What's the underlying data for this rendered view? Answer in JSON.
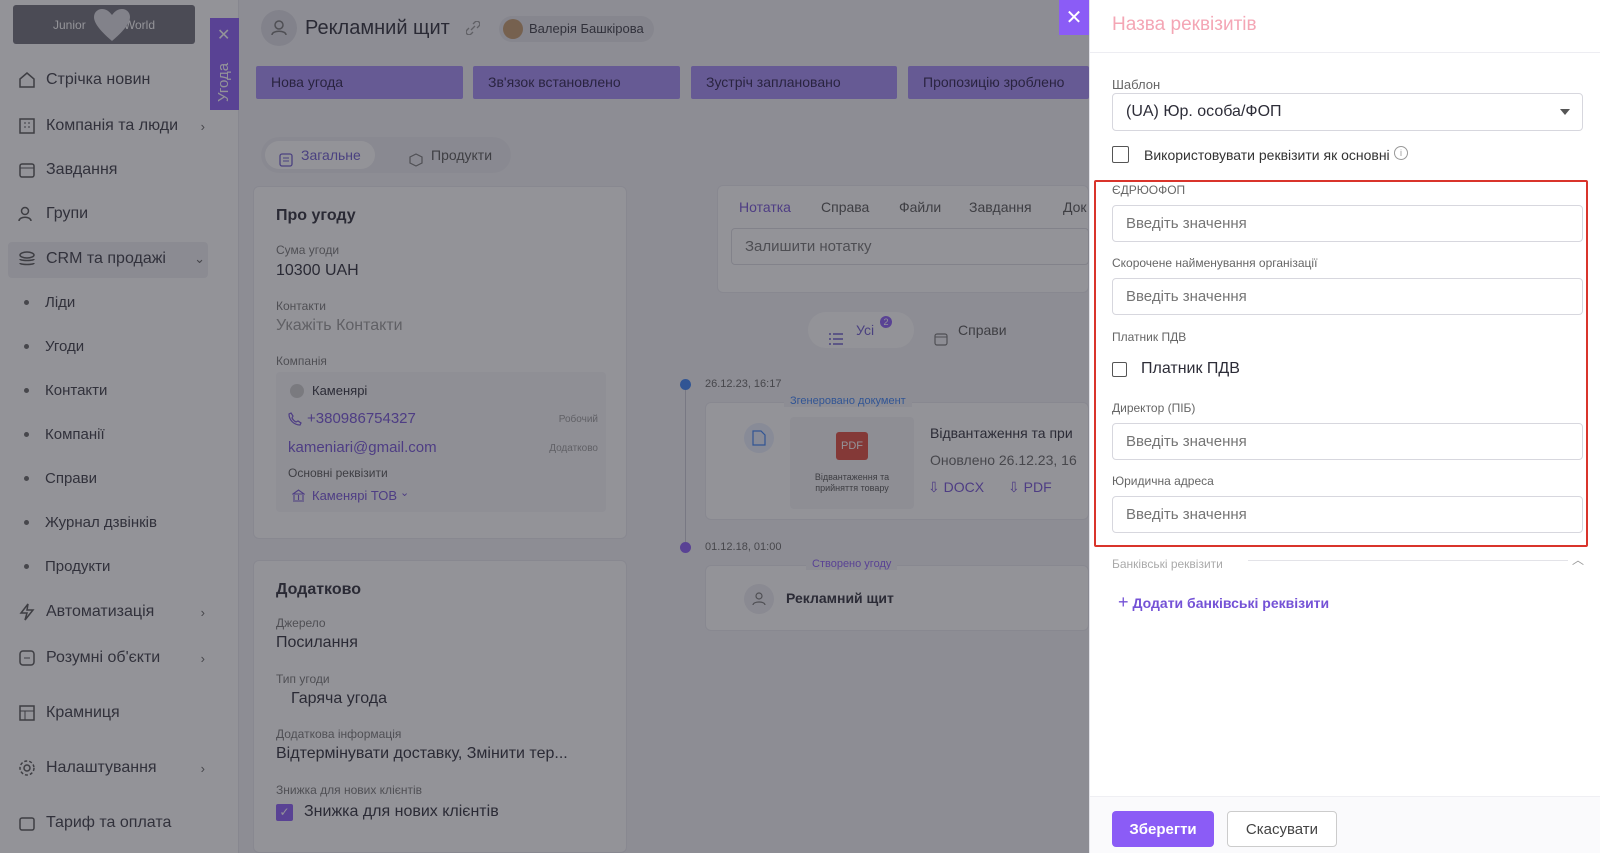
{
  "app": {
    "logo_left": "Junior",
    "logo_right": "World"
  },
  "sidebar": {
    "items": [
      {
        "label": "Стрічка новин",
        "icon": "home-icon"
      },
      {
        "label": "Компанія та люди",
        "icon": "building-icon"
      },
      {
        "label": "Завдання",
        "icon": "calendar-icon"
      },
      {
        "label": "Групи",
        "icon": "users-icon"
      },
      {
        "label": "CRM та продажі",
        "icon": "stack-icon"
      },
      {
        "label": "Автоматизація",
        "icon": "lightning-icon"
      },
      {
        "label": "Розумні об'єкти",
        "icon": "smart-object-icon"
      },
      {
        "label": "Крамниця",
        "icon": "shop-icon"
      },
      {
        "label": "Налаштування",
        "icon": "gear-icon"
      },
      {
        "label": "Тариф та оплата",
        "icon": "wallet-icon"
      }
    ],
    "subitems": [
      "Ліди",
      "Угоди",
      "Контакти",
      "Компанії",
      "Справи",
      "Журнал дзвінків",
      "Продукти"
    ]
  },
  "vertical_tab": {
    "label": "Угода"
  },
  "deal": {
    "title": "Рекламний щит",
    "owner": "Валерія Башкірова",
    "stages": [
      "Нова угода",
      "Зв'язок встановлено",
      "Зустріч заплановано",
      "Пропозицію зроблено"
    ],
    "tabs": [
      "Загальне",
      "Продукти"
    ]
  },
  "about": {
    "title": "Про угоду",
    "sum_label": "Сума угоди",
    "sum_value": "10300 UAH",
    "contacts_label": "Контакти",
    "contacts_placeholder": "Укажіть Контакти",
    "company_label": "Компанія",
    "company_name": "Каменярі",
    "phone": "+380986754327",
    "phone_type": "Робочий",
    "email": "kameniari@gmail.com",
    "email_type": "Додатково",
    "req_label": "Основні реквізити",
    "req_value": "Каменярі ТОВ"
  },
  "extra": {
    "title": "Додатково",
    "source_label": "Джерело",
    "source_value": "Посилання",
    "type_label": "Тип угоди",
    "type_value": "Гаряча угода",
    "info_label": "Додаткова інформація",
    "info_value": "Відтермінувати доставку, Змінити тер...",
    "discount_label": "Знижка для нових клієнтів",
    "discount_value": "Знижка для нових клієнтів"
  },
  "notes": {
    "tabs": [
      "Нотатка",
      "Справа",
      "Файли",
      "Завдання",
      "Док"
    ],
    "placeholder": "Залишити нотатку"
  },
  "feed": {
    "tabs": [
      {
        "label": "Усі",
        "badge": "2"
      },
      {
        "label": "Справи"
      }
    ],
    "entries": [
      {
        "time": "26.12.23, 16:17",
        "tag": "Згенеровано документ",
        "pdf": "PDF",
        "doc_caption": "Відвантаження та прийняття товару",
        "title": "Відвантаження та при",
        "updated": "Оновлено 26.12.23, 16",
        "dl1": "DOCX",
        "dl2": "PDF"
      },
      {
        "time": "01.12.18, 01:00",
        "tag": "Створено угоду",
        "title": "Рекламний щит"
      }
    ]
  },
  "panel": {
    "title": "Назва реквізитів",
    "template_label": "Шаблон",
    "template_value": "(UA) Юр. особа/ФОП",
    "use_main_label": "Використовувати реквізити як основні",
    "edrpou_label": "ЄДРЮОФОП",
    "short_name_label": "Скорочене найменування організації",
    "vat_label": "Платник ПДВ",
    "vat_checkbox": "Платник ПДВ",
    "director_label": "Директор (ПІБ)",
    "address_label": "Юридична адреса",
    "placeholder": "Введіть значення",
    "bank_label": "Банківські реквізити",
    "add_bank": "Додати банківські реквізити",
    "save": "Зберегти",
    "cancel": "Скасувати"
  },
  "colors": {
    "accent": "#8b5cf6",
    "highlight": "#d9342b",
    "title_pink": "#f4a6b5"
  }
}
